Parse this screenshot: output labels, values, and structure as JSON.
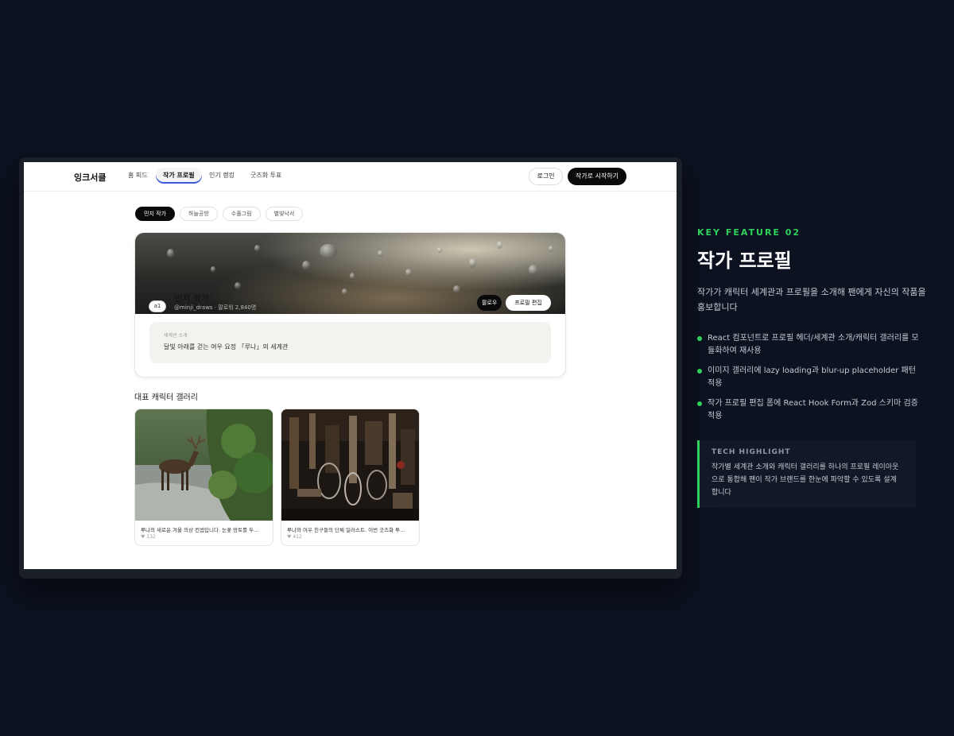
{
  "app": {
    "logo": "잉크서클",
    "nav": [
      "홈 피드",
      "작가 프로필",
      "인기 랭킹",
      "굿즈화 투표"
    ],
    "login": "로그인",
    "start": "작가로 시작하기"
  },
  "chips": [
    "민지 작가",
    "하늘공방",
    "수풀그림",
    "별빛낙서"
  ],
  "profile": {
    "avatar_alt": "a1",
    "name": "민지 작가",
    "handle": "@minji_draws · 팔로워 2,840명",
    "follow": "팔로우",
    "edit": "프로필 편집",
    "intro_label": "세계관 소개",
    "intro_text": "달빛 아래를 걷는 여우 요정 「루나」의 세계관"
  },
  "gallery": {
    "title": "대표 캐릭터 갤러리",
    "items": [
      {
        "caption": "루나의 새로운 겨울 의상 컨셉입니다. 눈꽃 망토를 두...",
        "likes": "132",
        "image": "deer-in-river"
      },
      {
        "caption": "루나와 여우 친구들의 단체 일러스트. 이번 굿즈화 투...",
        "likes": "412",
        "image": "hanging-tools"
      }
    ]
  },
  "feature": {
    "label": "KEY FEATURE 02",
    "title": "작가 프로필",
    "desc": "작가가 캐릭터 세계관과 프로필을 소개해 팬에게 자신의 작품을 홍보합니다",
    "bullets": [
      "React 컴포넌트로 프로필 헤더/세계관 소개/캐릭터 갤러리를 모듈화하여 재사용",
      "이미지 갤러리에 lazy loading과 blur-up placeholder 패턴 적용",
      "작가 프로필 편집 폼에 React Hook Form과 Zod 스키마 검증 적용"
    ],
    "tech_label": "TECH HIGHLIGHT",
    "tech_text": "작가별 세계관 소개와 캐릭터 갤러리를 하나의 프로필 레이아웃으로 통합해 팬이 작가 브랜드를 한눈에 파악할 수 있도록 설계합니다"
  },
  "colors": {
    "accent": "#2fd15a",
    "background": "#0c1220",
    "black": "#0a0a0a"
  }
}
